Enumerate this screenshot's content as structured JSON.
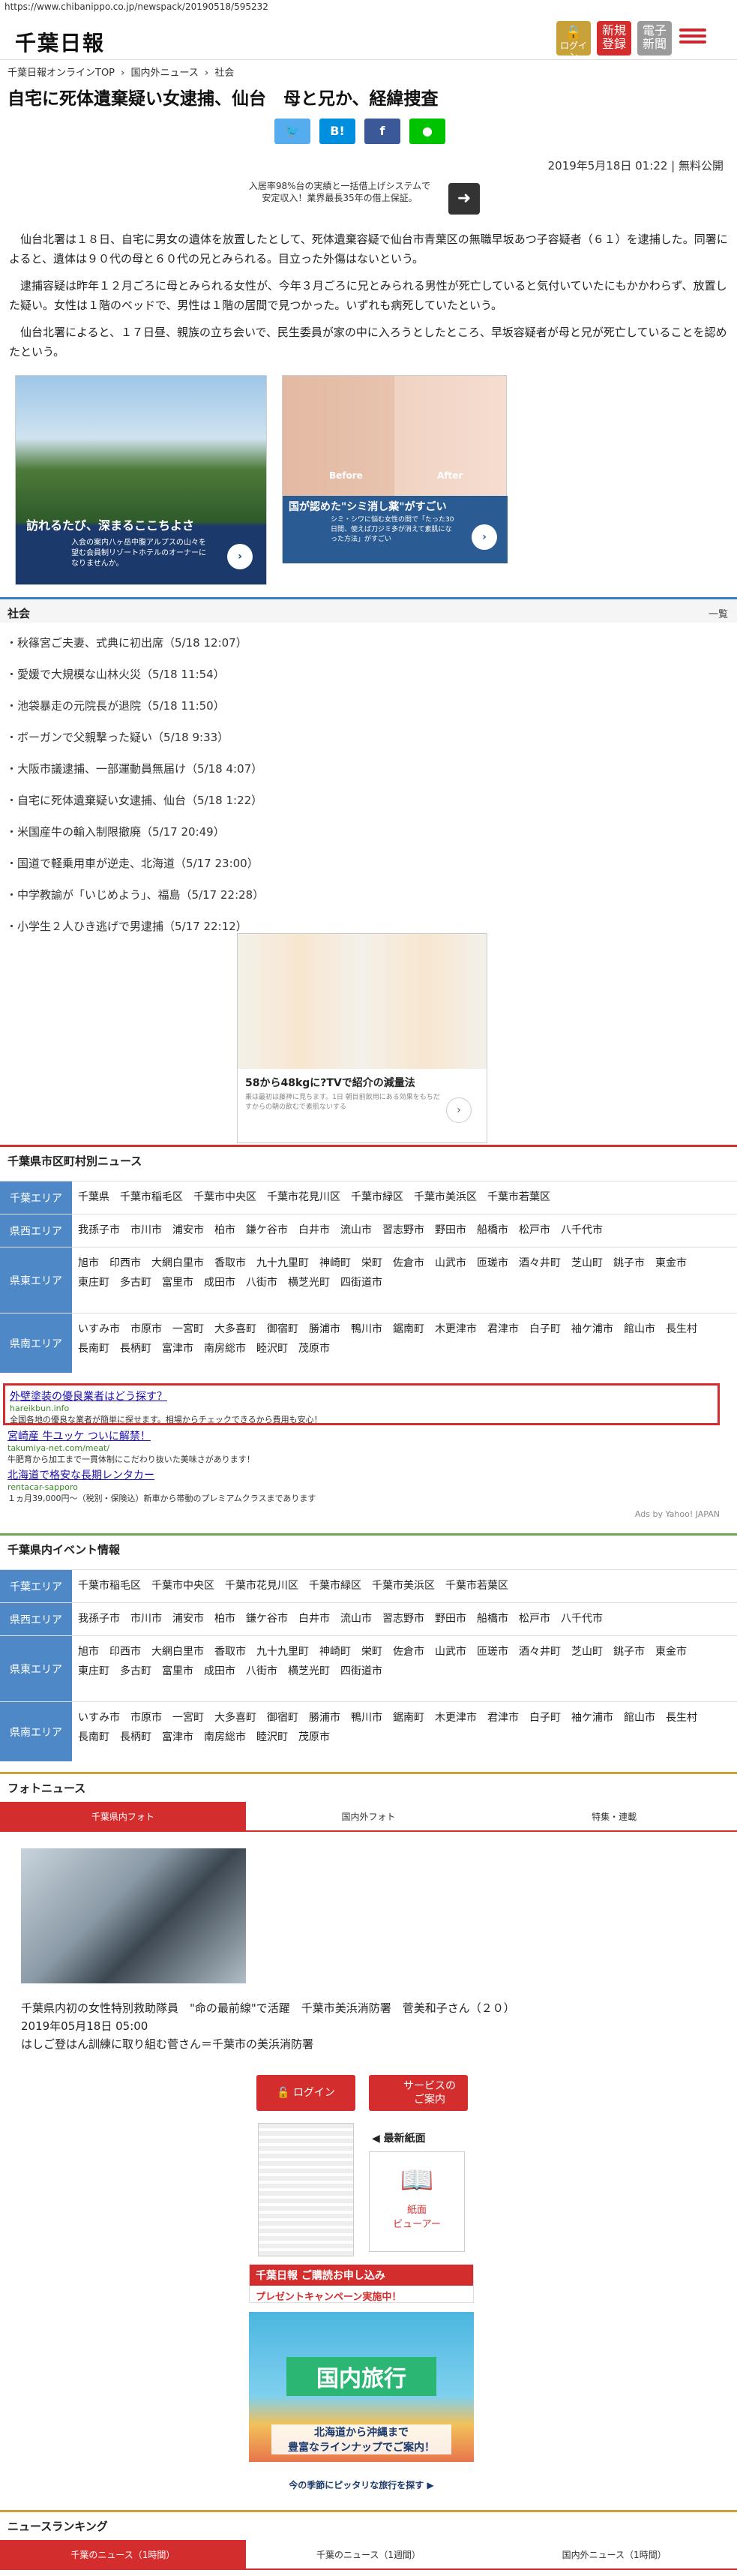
{
  "url": "https://www.chibanippo.co.jp/newspack/20190518/595232",
  "header": {
    "logo": "千葉日報",
    "login": "ログイン",
    "register": "新規\n登録",
    "epaper": "電子\n新聞"
  },
  "breadcrumb": [
    "千葉日報オンラインTOP",
    "›",
    "国内外ニュース",
    "›",
    "社会"
  ],
  "article": {
    "title": "自宅に死体遺棄疑い女逮捕、仙台　母と兄か、経緯捜査",
    "date": "2019年5月18日 01:22 | 無料公開",
    "ad_text": "入居率98%台の実績と一括借上げシステムで安定収入！業界最長35年の借上保証。",
    "paragraphs": [
      "仙台北署は１８日、自宅に男女の遺体を放置したとして、死体遺棄容疑で仙台市青葉区の無職早坂あつ子容疑者（６１）を逮捕した。同署によると、遺体は９０代の母と６０代の兄とみられる。目立った外傷はないという。",
      "逮捕容疑は昨年１２月ごろに母とみられる女性が、今年３月ごろに兄とみられる男性が死亡していると気付いていたにもかかわらず、放置した疑い。女性は１階のベッドで、男性は１階の居間で見つかった。いずれも病死していたという。",
      "仙台北署によると、１７日昼、親族の立ち会いで、民生委員が家の中に入ろうとしたところ、早坂容疑者が母と兄が死亡していることを認めたという。"
    ],
    "ad1_title": "訪れるたび、深まるここちよさ",
    "ad1_sub": "入会の案内八ヶ岳中腹アルプスの山々を望む会員制リゾートホテルのオーナーになりませんか。",
    "ad2_before": "Before",
    "ad2_after": "After",
    "ad2_title": "国が認めた\"シミ消し薬\"がすごい",
    "ad2_sub": "シミ・シワに悩む女性の間で「たった30日間、使えば刀ジミ多が消えて素肌になった方法」がすごい"
  },
  "society": {
    "heading": "社会",
    "more": "一覧",
    "items": [
      {
        "title": "秋篠宮ご夫妻、式典に初出席",
        "time": "（5/18 12:07）"
      },
      {
        "title": "愛媛で大規模な山林火災",
        "time": "（5/18 11:54）"
      },
      {
        "title": "池袋暴走の元院長が退院",
        "time": "（5/18 11:50）"
      },
      {
        "title": "ボーガンで父親撃った疑い",
        "time": "（5/18 9:33）"
      },
      {
        "title": "大阪市議逮捕、一部運動員無届け",
        "time": "（5/18 4:07）"
      },
      {
        "title": "自宅に死体遺棄疑い女逮捕、仙台",
        "time": "（5/18 1:22）"
      },
      {
        "title": "米国産牛の輸入制限撤廃",
        "time": "（5/17 20:49）"
      },
      {
        "title": "国道で軽乗用車が逆走、北海道",
        "time": "（5/17 23:00）"
      },
      {
        "title": "中学教諭が「いじめよう」、福島",
        "time": "（5/17 22:28）"
      },
      {
        "title": "小学生２人ひき逃げで男逮捕",
        "time": "（5/17 22:12）"
      }
    ]
  },
  "ad3": {
    "title": "58から48kgに?TVで紹介の減量法",
    "sub": "乗は最初は藤神に見ちます。1日 朝目前飲用にある効果をもちだすからの朝の飲むで素肌ないする"
  },
  "city": {
    "heading": "千葉県市区町村別ニュース",
    "rows": [
      {
        "label": "千葉エリア",
        "links": [
          "千葉県",
          "千葉市稲毛区",
          "千葉市中央区",
          "千葉市花見川区",
          "千葉市緑区",
          "千葉市美浜区",
          "千葉市若葉区"
        ]
      },
      {
        "label": "県西エリア",
        "links": [
          "我孫子市",
          "市川市",
          "浦安市",
          "柏市",
          "鎌ケ谷市",
          "白井市",
          "流山市",
          "習志野市",
          "野田市",
          "船橋市",
          "松戸市",
          "八千代市"
        ]
      },
      {
        "label": "県東エリア",
        "links": [
          "旭市",
          "印西市",
          "大網白里市",
          "香取市",
          "九十九里町",
          "神崎町",
          "栄町",
          "佐倉市",
          "山武市",
          "匝瑳市",
          "酒々井町",
          "芝山町",
          "銚子市",
          "東金市",
          "東庄町",
          "多古町",
          "富里市",
          "成田市",
          "八街市",
          "横芝光町",
          "四街道市"
        ]
      },
      {
        "label": "県南エリア",
        "links": [
          "いすみ市",
          "市原市",
          "一宮町",
          "大多喜町",
          "御宿町",
          "勝浦市",
          "鴨川市",
          "鋸南町",
          "木更津市",
          "君津市",
          "白子町",
          "袖ケ浦市",
          "館山市",
          "長生村",
          "長南町",
          "長柄町",
          "富津市",
          "南房総市",
          "睦沢町",
          "茂原市"
        ]
      }
    ]
  },
  "ads": [
    {
      "title": "外壁塗装の優良業者はどう探す？",
      "url": "hareikbun.info",
      "desc": "全国各地の優良な業者が簡単に探せます。相場からチェックできるから費用も安心！"
    },
    {
      "title": "宮崎産 牛ユッケ ついに解禁！",
      "url": "takumiya-net.com/meat/",
      "desc": "牛肥育から加工まで一貫体制にこだわり抜いた美味さがあります！"
    },
    {
      "title": "北海道で格安な長期レンタカー",
      "url": "rentacar-sapporo",
      "desc": "１ヵ月39,000円〜（税別・保険込）新車から帯動のプレミアムクラスまであります"
    }
  ],
  "ads_credit": "Ads by Yahoo! JAPAN",
  "events": {
    "heading": "千葉県内イベント情報",
    "rows": [
      {
        "label": "千葉エリア",
        "links": [
          "千葉市稲毛区",
          "千葉市中央区",
          "千葉市花見川区",
          "千葉市緑区",
          "千葉市美浜区",
          "千葉市若葉区"
        ]
      },
      {
        "label": "県西エリア",
        "links": [
          "我孫子市",
          "市川市",
          "浦安市",
          "柏市",
          "鎌ケ谷市",
          "白井市",
          "流山市",
          "習志野市",
          "野田市",
          "船橋市",
          "松戸市",
          "八千代市"
        ]
      },
      {
        "label": "県東エリア",
        "links": [
          "旭市",
          "印西市",
          "大網白里市",
          "香取市",
          "九十九里町",
          "神崎町",
          "栄町",
          "佐倉市",
          "山武市",
          "匝瑳市",
          "酒々井町",
          "芝山町",
          "銚子市",
          "東金市",
          "東庄町",
          "多古町",
          "富里市",
          "成田市",
          "八街市",
          "横芝光町",
          "四街道市"
        ]
      },
      {
        "label": "県南エリア",
        "links": [
          "いすみ市",
          "市原市",
          "一宮町",
          "大多喜町",
          "御宿町",
          "勝浦市",
          "鴨川市",
          "鋸南町",
          "木更津市",
          "君津市",
          "白子町",
          "袖ケ浦市",
          "館山市",
          "長生村",
          "長南町",
          "長柄町",
          "富津市",
          "南房総市",
          "睦沢町",
          "茂原市"
        ]
      }
    ]
  },
  "photo": {
    "heading": "フォトニュース",
    "tabs": [
      "千葉県内フォト",
      "国内外フォト",
      "特集・連載"
    ],
    "caption": "千葉県内初の女性特別救助隊員　\"命の最前線\"で活躍　千葉市美浜消防署　菅美和子さん（２０）",
    "date": "2019年05月18日 05:00",
    "sub": "はしご登はん訓練に取り組む菅さん＝千葉市の美浜消防署"
  },
  "side": {
    "login": "ログイン",
    "service": "サービスの\nご案内",
    "latest": "◀ 最新紙面",
    "viewer": "紙面\nビューアー",
    "promo1": "千葉日報 ご購読お申し込み",
    "promo1_sub": "プレゼントキャンペーン実施中！",
    "travel_title": "国内旅行",
    "travel_sub": "北海道から沖縄まで\n豊富なラインナップでご案内！",
    "travel_footer": "今の季節にピッタリな旅行を探す ▶"
  },
  "ranking": {
    "heading": "ニュースランキング",
    "tabs": [
      "千葉のニュース（1時間）",
      "千葉のニュース（1週間）",
      "国内外ニュース（1時間）"
    ]
  },
  "colors": {
    "red": "#d42d2d",
    "blue": "#4e88c7",
    "twitter": "#55acee",
    "hatena": "#008fde",
    "facebook": "#3b5998",
    "line": "#00c300"
  }
}
